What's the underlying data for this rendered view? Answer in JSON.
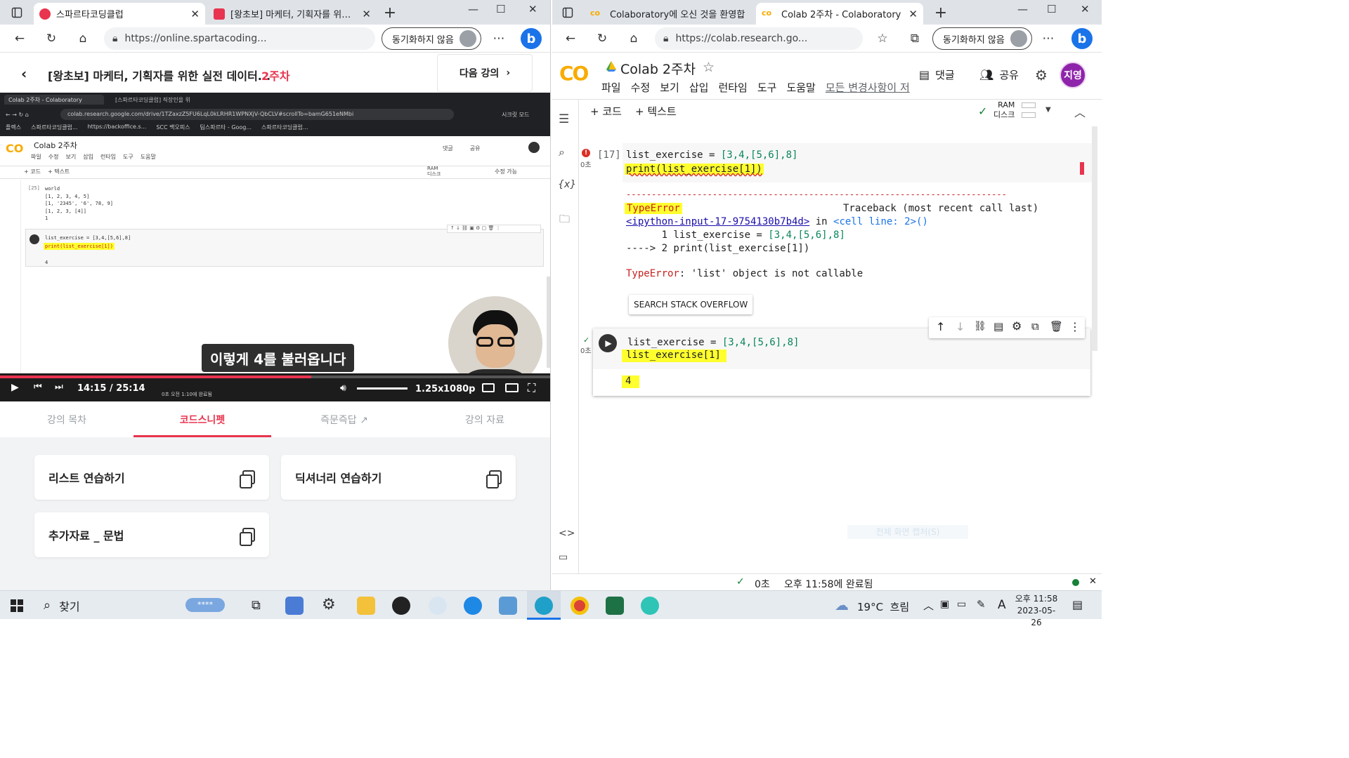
{
  "left_browser": {
    "tabs": [
      {
        "title": "스파르타코딩클럽",
        "active": true
      },
      {
        "title": "[왕초보] 마케터, 기획자를 위한 실",
        "active": false
      }
    ],
    "url": "https://online.spartacoding...",
    "sync_label": "동기화하지 않음"
  },
  "right_browser": {
    "tabs": [
      {
        "title": "Colaboratory에 오신 것을 환영합",
        "active": false
      },
      {
        "title": "Colab 2주차 - Colaboratory",
        "active": true
      }
    ],
    "url": "https://colab.research.go...",
    "sync_label": "동기화하지 않음"
  },
  "lecture": {
    "back_icon": "chevron-left-icon",
    "title": "[왕초보] 마케터, 기획자를 위한 실전 데이터...",
    "week": "2주차",
    "next_label": "다음 강의"
  },
  "video": {
    "inner_tabs": [
      "Colab 2주차 - Colaboratory",
      "[스파르타코딩클럽] 직장인을 위"
    ],
    "inner_url": "colab.research.google.com/drive/1TZaxzZ5FU6LqL0kLRHR1WPNXjV-QbCLV#scrollTo=bamG651eNMbi",
    "inner_profile": "시크릿 모드",
    "bookmarks": [
      "플렉스",
      "스파르타코딩클럽...",
      "https://backoffice.s...",
      "SCC 백오피스",
      "팀스파르타 - Goog...",
      "스파르타코딩클럽..."
    ],
    "colab_title": "Colab 2주차",
    "colab_menu": [
      "파일",
      "수정",
      "보기",
      "삽입",
      "런타임",
      "도구",
      "도움말"
    ],
    "colab_right": [
      "댓글",
      "공유"
    ],
    "add_code": "+ 코드",
    "add_text": "+ 텍스트",
    "ram_label": "RAM",
    "disk_label": "디스크",
    "edit_mode": "수정 가능",
    "prev_cell_num": "[25]",
    "prev_output": [
      "world",
      "[1, 2, 3, 4, 5]",
      "[1, '2345', '6', 78, 9]",
      "[1, 2, 3, [4]]",
      "1"
    ],
    "cell_line1": "list_exercise = [3,4,[5,6],8]",
    "cell_line2": "print(list_exercise[1])",
    "cell_output": "4",
    "subtitle": "이렇게 4를 불러옵니다",
    "time_current": "14:15",
    "time_total": "25:14",
    "speed": "1.25x",
    "quality": "1080p",
    "progress": 0.565,
    "volume": 1.0,
    "bottom_status": "0초    오전 1:10에 완료됨"
  },
  "snippets": {
    "tabs": [
      "강의 목차",
      "코드스니펫",
      "즉문즉답",
      "강의 자료"
    ],
    "active_tab": 1,
    "cards": [
      "리스트 연습하기",
      "딕셔너리 연습하기",
      "추가자료 _ 문법"
    ]
  },
  "colab": {
    "logo": "CO",
    "title": "Colab 2주차",
    "menu": [
      "파일",
      "수정",
      "보기",
      "삽입",
      "런타임",
      "도구",
      "도움말"
    ],
    "unsaved": "모든 변경사항이 저",
    "comment_label": "댓글",
    "share_label": "공유",
    "avatar_text": "지영",
    "add_code": "+ 코드",
    "add_text": "+ 텍스트",
    "ram_label": "RAM",
    "disk_label": "디스크",
    "cell1": {
      "num": "[17]",
      "time": "0초",
      "line1_var": "list_exercise",
      "line1_rest": " = ",
      "line1_val": "[3,4,[5,6],8]",
      "line2": "print(list_exercise[1])"
    },
    "error": {
      "dashes": "---------------------------------------------------------------------------",
      "type": "TypeError",
      "traceback": "Traceback (most recent call last)",
      "link": "<ipython-input-17-9754130b7b4d>",
      "in_text": " in ",
      "cell_line": "<cell line: 2>()",
      "line_a_prefix": "      1 list_exercise = ",
      "line_a_val": "[3,4,[5,6],8]",
      "line_b": "----> 2 print(list_exercise[1])",
      "msg_type": "TypeError",
      "msg": ": 'list' object is not callable",
      "button": "SEARCH STACK OVERFLOW"
    },
    "cell2": {
      "time": "0초",
      "line1_var": "list_exercise",
      "line1_rest": " = ",
      "line1_val": "[3,4,[5,6],8]",
      "line2": "list_exercise[1]",
      "output": "4"
    },
    "ghost_text": "전체 화면 캡처(S)",
    "status_time": "0초",
    "status_done": "오후 11:58에 완료됨"
  },
  "taskbar": {
    "search": "찾기",
    "weather": "19°C  흐림",
    "ime": "A",
    "clock_time": "오후 11:58",
    "clock_date": "2023-05-26"
  },
  "colors": {
    "brand_red": "#e8344e",
    "colab_orange": "#f9ab00",
    "highlight": "#ffff2e",
    "avatar": "#8e24aa"
  }
}
